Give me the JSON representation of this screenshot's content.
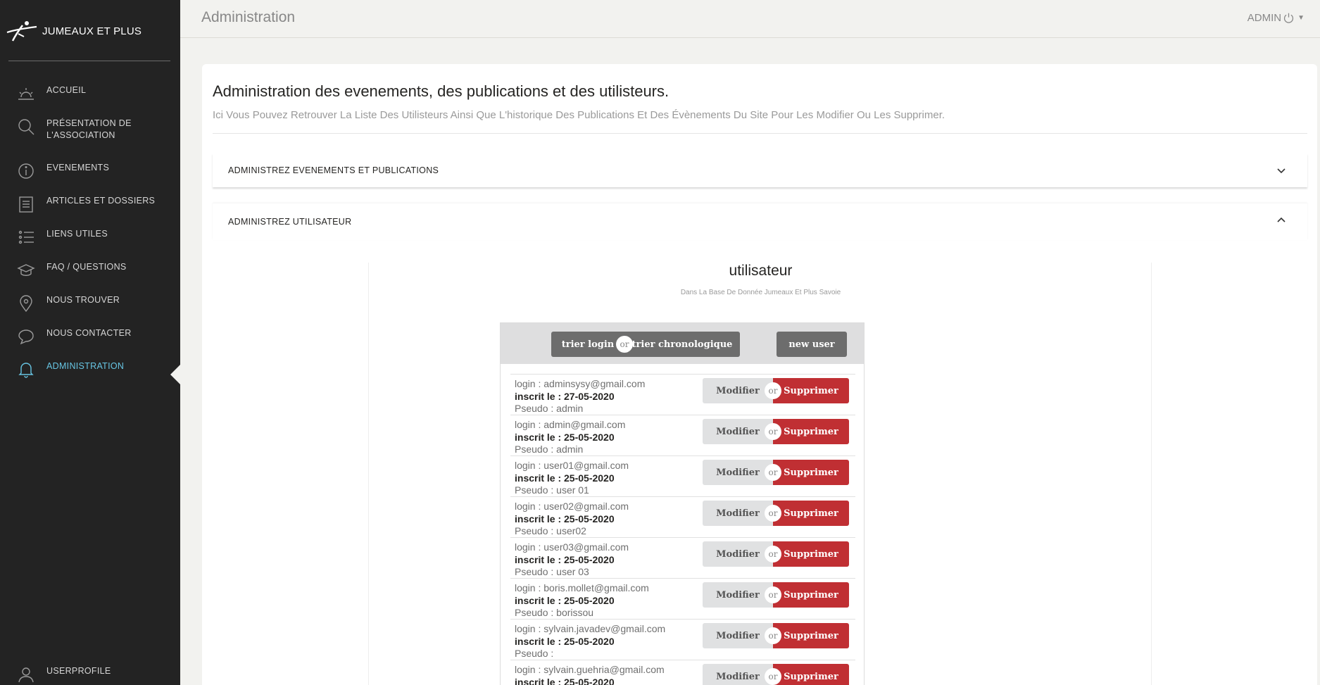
{
  "brand": {
    "name": "JUMEAUX ET PLUS"
  },
  "sidebar": {
    "items": [
      {
        "label": "ACCUEIL",
        "icon": "sunrise-icon"
      },
      {
        "label": "PRÉSENTATION DE L'ASSOCIATION",
        "icon": "search-icon"
      },
      {
        "label": "EVENEMENTS",
        "icon": "info-icon"
      },
      {
        "label": "ARTICLES ET DOSSIERS",
        "icon": "document-icon"
      },
      {
        "label": "LIENS UTILES",
        "icon": "list-icon"
      },
      {
        "label": "FAQ / QUESTIONS",
        "icon": "graduation-cap-icon"
      },
      {
        "label": "NOUS TROUVER",
        "icon": "map-pin-icon"
      },
      {
        "label": "NOUS CONTACTER",
        "icon": "chat-icon"
      },
      {
        "label": "ADMINISTRATION",
        "icon": "bell-icon"
      }
    ],
    "bottom": {
      "label": "USERPROFILE",
      "icon": "user-icon"
    },
    "active_color": "#67c5e3"
  },
  "topbar": {
    "title": "Administration",
    "user": "ADMIN"
  },
  "main": {
    "title": "Administration des evenements, des publications et des utilisteurs.",
    "subtitle": "Ici Vous Pouvez Retrouver La Liste Des Utilisteurs Ainsi Que L'historique Des Publications Et Des Évènements Du Site Pour Les Modifier Ou Les Supprimer.",
    "accordion1": "ADMINISTREZ EVENEMENTS ET PUBLICATIONS",
    "accordion2": "ADMINISTREZ UTILISATEUR"
  },
  "users": {
    "title": "utilisateur",
    "subtitle": "Dans La Base De Donnée Jumeaux Et Plus Savoie",
    "sort_login": "trier login",
    "or": "or",
    "sort_chrono": "trier chronologique",
    "new_user": "new user",
    "modify": "Modifier",
    "delete": "Supprimer",
    "delete_color": "#c02f33",
    "rows": [
      {
        "login": "login : adminsysy@gmail.com",
        "date": "inscrit le : 27-05-2020",
        "pseudo": "Pseudo : admin"
      },
      {
        "login": "login : admin@gmail.com",
        "date": "inscrit le : 25-05-2020",
        "pseudo": "Pseudo : admin"
      },
      {
        "login": "login : user01@gmail.com",
        "date": "inscrit le : 25-05-2020",
        "pseudo": "Pseudo : user 01"
      },
      {
        "login": "login : user02@gmail.com",
        "date": "inscrit le : 25-05-2020",
        "pseudo": "Pseudo : user02"
      },
      {
        "login": "login : user03@gmail.com",
        "date": "inscrit le : 25-05-2020",
        "pseudo": "Pseudo : user 03"
      },
      {
        "login": "login : boris.mollet@gmail.com",
        "date": "inscrit le : 25-05-2020",
        "pseudo": "Pseudo : borissou"
      },
      {
        "login": "login : sylvain.javadev@gmail.com",
        "date": "inscrit le : 25-05-2020",
        "pseudo": "Pseudo :"
      },
      {
        "login": "login : sylvain.guehria@gmail.com",
        "date": "inscrit le : 25-05-2020",
        "pseudo": ""
      }
    ]
  }
}
